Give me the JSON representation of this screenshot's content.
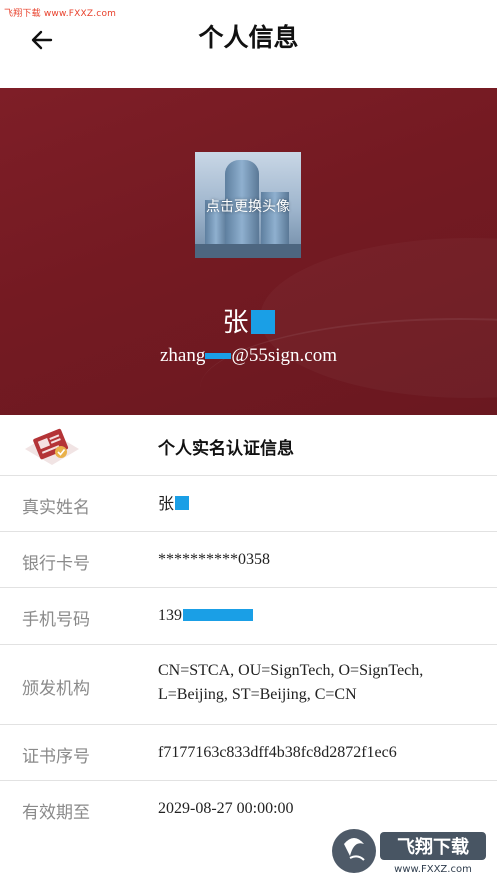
{
  "watermark_top": "飞翔下载 www.FXXZ.com",
  "header": {
    "title": "个人信息"
  },
  "profile": {
    "avatar_label": "点击更换头像",
    "name": "张",
    "email_prefix": "zhang",
    "email_suffix": "@55sign.com"
  },
  "cert": {
    "section_title": "个人实名认证信息",
    "rows": [
      {
        "label": "真实姓名",
        "value": "张"
      },
      {
        "label": "银行卡号",
        "value": "**********0358"
      },
      {
        "label": "手机号码",
        "value": "139"
      },
      {
        "label": "颁发机构",
        "value_line1": "CN=STCA, OU=SignTech, O=SignTech,",
        "value_line2": "L=Beijing, ST=Beijing, C=CN"
      },
      {
        "label": "证书序号",
        "value": "f7177163c833dff4b38fc8d2872f1ec6"
      },
      {
        "label": "有效期至",
        "value": "2029-08-27 00:00:00"
      }
    ]
  },
  "watermark_bottom": {
    "brand": "飞翔下载",
    "url": "www.FXXZ.com"
  },
  "colors": {
    "banner": "#7a1c25",
    "mask": "#1a9fe6",
    "label": "#8a8a8a",
    "divider": "#e2e2e2"
  }
}
